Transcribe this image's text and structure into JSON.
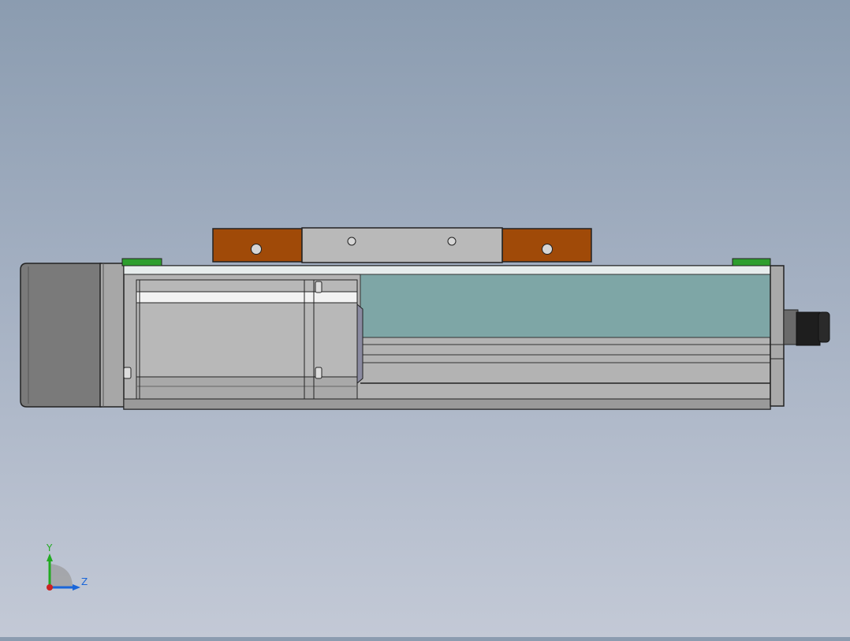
{
  "view": {
    "type": "3d-cad-viewport",
    "colors": {
      "background_top": "#8b9cb0",
      "background_bottom": "#c3c9d6",
      "carriage_copper": "#a04a08",
      "carriage_steel": "#b9b9b9",
      "rail_cover": "#7ea6a6",
      "body_aluminum": "#b3b3b3",
      "motor_housing": "#7a7a7a",
      "end_stop_green": "#2e9e2e",
      "connector_black": "#1e1e1e"
    },
    "components": [
      {
        "name": "stepper-motor",
        "color_key": "motor_housing"
      },
      {
        "name": "carriage",
        "color_key": "carriage_copper"
      },
      {
        "name": "linear-rail-body",
        "color_key": "body_aluminum"
      },
      {
        "name": "cable-connector",
        "color_key": "connector_black"
      }
    ]
  },
  "triad": {
    "y_label": "Y",
    "z_label": "Z"
  }
}
